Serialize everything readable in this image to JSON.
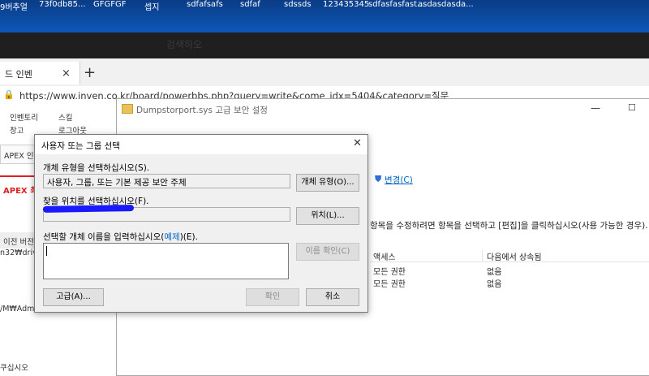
{
  "desktop": {
    "icons": [
      "9버추얼",
      "73f0db85...",
      "GFGFGF",
      "셉지",
      "sdfafsafs",
      "sdfaf",
      "sdssds",
      "123435345",
      "sdfasfasfast...",
      "asdasdasda..."
    ],
    "bg_color": "#0d57b7"
  },
  "browser": {
    "search_hint": "검색하오",
    "tab": {
      "label": "드 인벤",
      "close": "×"
    },
    "new_tab": "+",
    "url": "https://www.inven.co.kr/board/powerbbs.php?query=write&come_idx=5404&category=질문"
  },
  "webpage": {
    "nav1": "인벤토리",
    "nav2": "스킬",
    "nav3": "창고",
    "nav4": "로그아웃",
    "apex_box": "APEX 인",
    "apex_red": "APEX 최",
    "prev_ver": "이전 버전",
    "path1": "n32₩drive",
    "path2": "/M₩Admi",
    "bottom": "쿠십시오"
  },
  "adv_window": {
    "title": "Dumpstorport.sys 고급 보안 설정",
    "minimize": "—",
    "maximize": "☐",
    "change_link": "변경(C)",
    "perm_desc": "항목을 수정하려면 항목을 선택하고 [편집]을 클릭하십시오(사용 가능한 경우).",
    "columns": [
      "액세스",
      "다음에서 상속됨"
    ],
    "rows": [
      {
        "access": "모든 권한",
        "inherited": "없음"
      },
      {
        "access": "모든 권한",
        "inherited": "없음"
      }
    ]
  },
  "dialog": {
    "title": "사용자 또는 그룹 선택",
    "close": "✕",
    "object_type_label": "개체 유형을 선택하십시오(S).",
    "object_type_value": "사용자, 그룹, 또는 기본 제공 보안 주체",
    "object_type_button": "개체 유형(O)...",
    "location_label": "찾을 위치를 선택하십시오(F).",
    "location_button": "위치(L)...",
    "enter_label_prefix": "선택할 개체 이름을 입력하십시오(",
    "enter_label_link": "예제",
    "enter_label_suffix": ")(E).",
    "check_names_button": "이름 확인(C)",
    "advanced_button": "고급(A)...",
    "ok_button": "확인",
    "cancel_button": "취소"
  },
  "colors": {
    "link": "#0066cc",
    "redaction": "#1a1aff"
  }
}
